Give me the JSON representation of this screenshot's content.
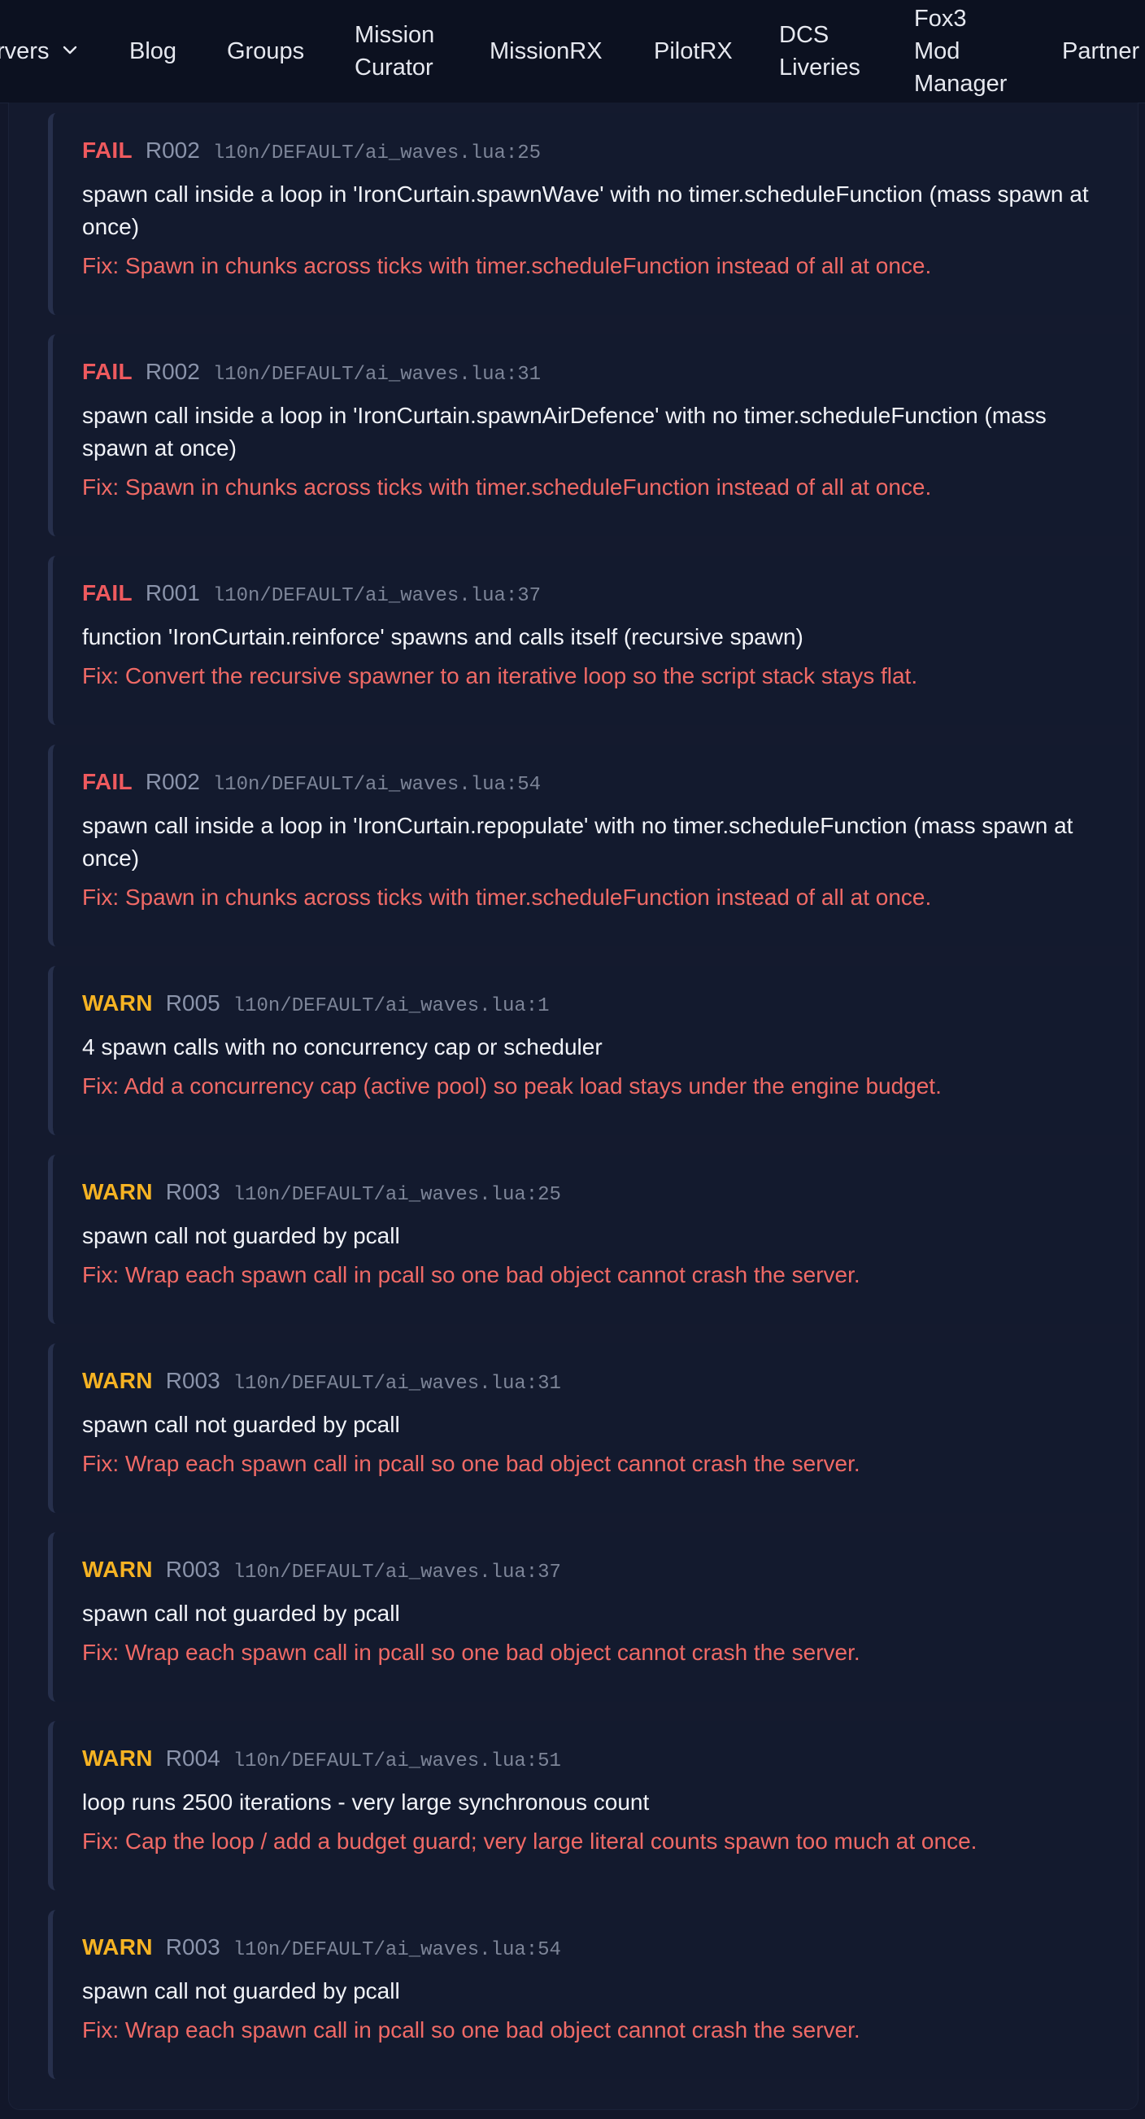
{
  "nav": {
    "items": [
      {
        "label": "rvers"
      },
      {
        "label": "Blog"
      },
      {
        "label": "Groups"
      },
      {
        "label": "Mission Curator"
      },
      {
        "label": "MissionRX"
      },
      {
        "label": "PilotRX"
      },
      {
        "label": "DCS Liveries"
      },
      {
        "label": "Fox3 Mod Manager"
      },
      {
        "label": "Partner"
      }
    ]
  },
  "issues": [
    {
      "severity": "FAIL",
      "rule": "R002",
      "location": "l10n/DEFAULT/ai_waves.lua:25",
      "message": "spawn call inside a loop in 'IronCurtain.spawnWave' with no timer.scheduleFunction (mass spawn at once)",
      "fix": "Fix: Spawn in chunks across ticks with timer.scheduleFunction instead of all at once."
    },
    {
      "severity": "FAIL",
      "rule": "R002",
      "location": "l10n/DEFAULT/ai_waves.lua:31",
      "message": "spawn call inside a loop in 'IronCurtain.spawnAirDefence' with no timer.scheduleFunction (mass spawn at once)",
      "fix": "Fix: Spawn in chunks across ticks with timer.scheduleFunction instead of all at once."
    },
    {
      "severity": "FAIL",
      "rule": "R001",
      "location": "l10n/DEFAULT/ai_waves.lua:37",
      "message": "function 'IronCurtain.reinforce' spawns and calls itself (recursive spawn)",
      "fix": "Fix: Convert the recursive spawner to an iterative loop so the script stack stays flat."
    },
    {
      "severity": "FAIL",
      "rule": "R002",
      "location": "l10n/DEFAULT/ai_waves.lua:54",
      "message": "spawn call inside a loop in 'IronCurtain.repopulate' with no timer.scheduleFunction (mass spawn at once)",
      "fix": "Fix: Spawn in chunks across ticks with timer.scheduleFunction instead of all at once."
    },
    {
      "severity": "WARN",
      "rule": "R005",
      "location": "l10n/DEFAULT/ai_waves.lua:1",
      "message": "4 spawn calls with no concurrency cap or scheduler",
      "fix": "Fix: Add a concurrency cap (active pool) so peak load stays under the engine budget."
    },
    {
      "severity": "WARN",
      "rule": "R003",
      "location": "l10n/DEFAULT/ai_waves.lua:25",
      "message": "spawn call not guarded by pcall",
      "fix": "Fix: Wrap each spawn call in pcall so one bad object cannot crash the server."
    },
    {
      "severity": "WARN",
      "rule": "R003",
      "location": "l10n/DEFAULT/ai_waves.lua:31",
      "message": "spawn call not guarded by pcall",
      "fix": "Fix: Wrap each spawn call in pcall so one bad object cannot crash the server."
    },
    {
      "severity": "WARN",
      "rule": "R003",
      "location": "l10n/DEFAULT/ai_waves.lua:37",
      "message": "spawn call not guarded by pcall",
      "fix": "Fix: Wrap each spawn call in pcall so one bad object cannot crash the server."
    },
    {
      "severity": "WARN",
      "rule": "R004",
      "location": "l10n/DEFAULT/ai_waves.lua:51",
      "message": "loop runs 2500 iterations - very large synchronous count",
      "fix": "Fix: Cap the loop / add a budget guard; very large literal counts spawn too much at once."
    },
    {
      "severity": "WARN",
      "rule": "R003",
      "location": "l10n/DEFAULT/ai_waves.lua:54",
      "message": "spawn call not guarded by pcall",
      "fix": "Fix: Wrap each spawn call in pcall so one bad object cannot crash the server."
    }
  ]
}
